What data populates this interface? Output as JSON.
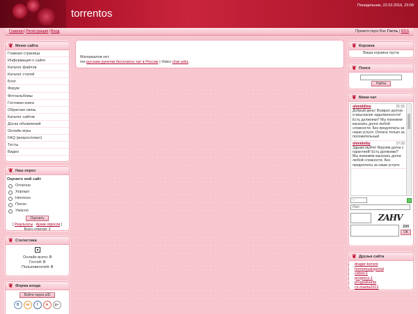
{
  "header": {
    "site_title": "torrentos",
    "datetime": "Понедельник, 22.02.2016, 23:09"
  },
  "navbar": {
    "links": [
      "Главная",
      "Регистрация",
      "Вход"
    ],
    "greeting_prefix": "Приветствую Вас ",
    "greeting_user": "Гость",
    "rss": "RSS"
  },
  "site_menu": {
    "title": "Меню сайта",
    "items": [
      "Главная страница",
      "Информация о сайте",
      "Каталог файлов",
      "Каталог статей",
      "Блог",
      "Форум",
      "Фотоальбомы",
      "Гостевая книга",
      "Обратная связь",
      "Каталог сайтов",
      "Доска объявлений",
      "Онлайн игры",
      "FAQ (вопрос/ответ)",
      "Тесты",
      "Видео"
    ]
  },
  "poll": {
    "title": "Наш опрос",
    "question": "Оцените мой сайт",
    "options": [
      "Отлично",
      "Хорошо",
      "Неплохо",
      "Плохо",
      "Ужасно"
    ],
    "vote_label": "Оценить",
    "results_link": "Результаты",
    "archive_link": "Архив опросов",
    "total": "Всего ответов: 3"
  },
  "stats": {
    "title": "Статистика",
    "online_label": "Онлайн всего:",
    "online_value": "0",
    "guests_label": "Гостей:",
    "guests_value": "0",
    "users_label": "Пользователей:",
    "users_value": "0"
  },
  "login": {
    "title": "Форма входа",
    "ucoz_button": "Войти через uID",
    "social": [
      "В",
      "ок",
      "f",
      "я",
      "g+"
    ]
  },
  "main": {
    "no_materials": "Материалов нет",
    "line_prefix": "mo ",
    "link1": "русские рунетки бесплатно чат в России",
    "middle": " | Video ",
    "link2": "chat seks",
    "suffix": "."
  },
  "cart": {
    "title": "Корзина",
    "empty": "Ваша корзина пуста"
  },
  "search": {
    "title": "Поиск",
    "button": "Найти"
  },
  "chat": {
    "title": "Мини-чат",
    "messages": [
      {
        "user": "shmiddlzw",
        "time": "21:31",
        "text": "Добрый день! Возврат долгов и взыскание задолженности! Есть должники? Мы поможем взыскать долги любой сложности. Без предоплаты за наши услуги. Оплата только за положительный"
      },
      {
        "user": "shmidslby",
        "time": "17:32",
        "text": "Здравствуйте! Вернём долги с гарантией! Есть должники? Мы поможем взыскать долги любой сложности. Без предоплаты за наши услуги."
      }
    ],
    "name_placeholder": "Имя",
    "captcha_text": "ZAHV",
    "char_count": "200",
    "ok_button": "OK",
    "select_value": "--"
  },
  "friends": {
    "title": "Друзья сайта",
    "links": [
      "drager-torrent",
      "homemusicportal",
      "catsec1",
      "progmcs-1",
      "progsalvants",
      "cs-mania2012"
    ]
  },
  "colors": {
    "accent": "#b0002a",
    "header": "#c9253c",
    "background": "#f7c6cf"
  }
}
